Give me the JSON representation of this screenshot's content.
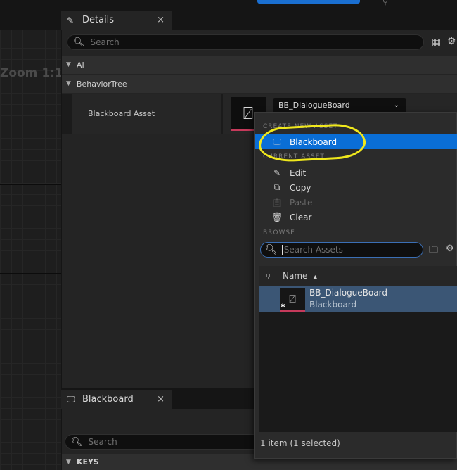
{
  "graph": {
    "zoom_label": "Zoom 1:1"
  },
  "details_tab": {
    "title": "Details",
    "close": "×"
  },
  "details_search": {
    "placeholder": "Search"
  },
  "categories": {
    "ai": "AI",
    "behavior_tree": "BehaviorTree"
  },
  "property": {
    "name": "Blackboard Asset",
    "value": "BB_DialogueBoard"
  },
  "menu": {
    "create_header": "CREATE NEW ASSET",
    "create_item": "Blackboard",
    "current_header": "CURRENT ASSET",
    "edit": "Edit",
    "copy": "Copy",
    "paste": "Paste",
    "clear": "Clear",
    "browse_header": "BROWSE",
    "search_placeholder": "Search Assets",
    "column_name": "Name",
    "asset_name": "BB_DialogueBoard",
    "asset_type": "Blackboard",
    "status": "1 item (1 selected)"
  },
  "blackboard_tab": {
    "title": "Blackboard",
    "close": "×"
  },
  "blackboard_search": {
    "placeholder": "Search"
  },
  "keys_category": "KEYS",
  "colors": {
    "selection": "#0a6ed6",
    "highlight": "#f0e81c",
    "asset_underline": "#c63a5b"
  }
}
